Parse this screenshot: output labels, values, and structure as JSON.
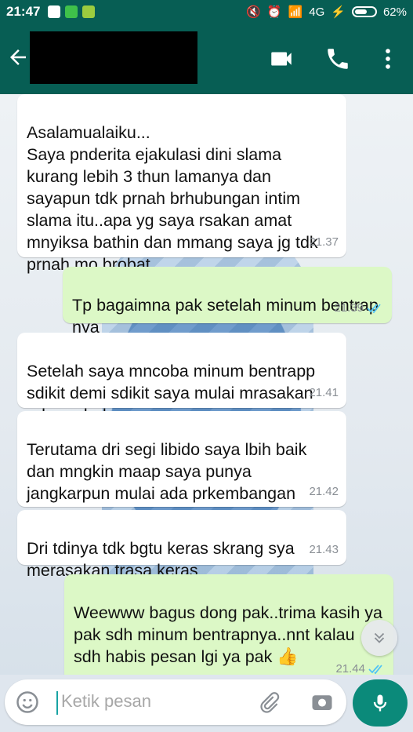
{
  "status_bar": {
    "time": "21:47",
    "network": "4G",
    "battery": "62%",
    "battery_level": 0.62
  },
  "header": {
    "contact_name_redacted": true,
    "icons": [
      "back-arrow-icon",
      "video-call-icon",
      "phone-icon",
      "more-vert-icon"
    ]
  },
  "messages": [
    {
      "direction": "in",
      "text": "Asalamualaiku...\nSaya pnderita ejakulasi dini slama kurang lebih 3 thun lamanya dan sayapun tdk prnah brhubungan intim slama itu..apa yg saya rsakan amat mnyiksa bathin dan mmang saya jg tdk prnah mo brobat ..",
      "time": "21.37"
    },
    {
      "direction": "out",
      "text": "Tp bagaimna pak setelah minum bentrap nya",
      "time": "21.39",
      "read": true
    },
    {
      "direction": "in",
      "text": "Setelah saya mncoba minum bentrapp sdikit demi sdikit saya mulai mrasakan ada prubahan",
      "time": "21.41"
    },
    {
      "direction": "in",
      "text": "Terutama dri segi libido saya lbih baik dan mngkin maap saya punya jangkarpun mulai ada prkembangan",
      "time": "21.42"
    },
    {
      "direction": "in",
      "text": "Dri tdinya tdk bgtu keras skrang sya merasakan trasa keras",
      "time": "21.43"
    },
    {
      "direction": "out",
      "text": "Weewww bagus dong pak..trima kasih ya pak sdh minum bentrapnya..nnt kalau sdh habis pesan lgi ya pak",
      "time": "21.44",
      "read": true,
      "emoji": "👍"
    }
  ],
  "composer": {
    "placeholder": "Ketik pesan"
  },
  "colors": {
    "header": "#075e54",
    "incoming_bubble": "#ffffff",
    "outgoing_bubble": "#dcf8c6",
    "read_tick": "#4fc3f7",
    "mic_button": "#0b8a7a"
  }
}
